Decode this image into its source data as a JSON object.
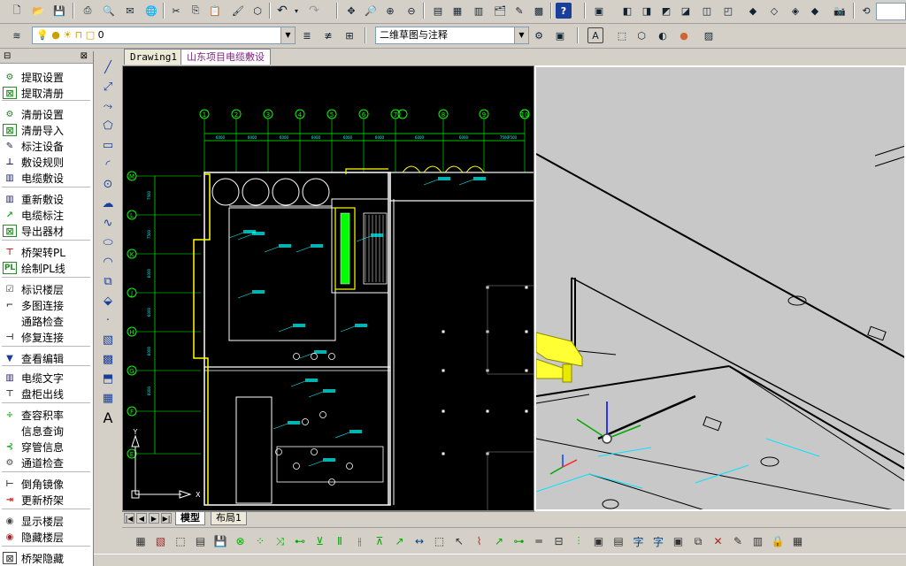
{
  "layer_combo": {
    "value": "0"
  },
  "workspace_combo": {
    "value": "二维草图与注释"
  },
  "document_tabs": [
    {
      "label": "Drawing1"
    },
    {
      "label": "山东项目电缆敷设"
    }
  ],
  "layout_tabs": [
    {
      "label": "模型"
    },
    {
      "label": "布局1"
    }
  ],
  "left_panel": {
    "items": [
      {
        "label": "提取设置",
        "icon": "extract-settings-icon"
      },
      {
        "label": "提取清册",
        "icon": "extract-list-icon"
      },
      {
        "label": "清册设置",
        "icon": "list-settings-icon"
      },
      {
        "label": "清册导入",
        "icon": "list-import-icon"
      },
      {
        "label": "标注设备",
        "icon": "mark-device-icon"
      },
      {
        "label": "敷设规则",
        "icon": "laying-rule-icon"
      },
      {
        "label": "电缆敷设",
        "icon": "cable-laying-icon"
      },
      {
        "label": "重新敷设",
        "icon": "relay-icon"
      },
      {
        "label": "电缆标注",
        "icon": "cable-label-icon"
      },
      {
        "label": "导出器材",
        "icon": "export-material-icon"
      },
      {
        "label": "桥架转PL",
        "icon": "tray-to-pl-icon"
      },
      {
        "label": "绘制PL线",
        "icon": "draw-pl-icon"
      },
      {
        "label": "标识楼层",
        "icon": "mark-floor-icon"
      },
      {
        "label": "多图连接",
        "icon": "multi-connect-icon"
      },
      {
        "label": "通路检查",
        "icon": "path-check-icon"
      },
      {
        "label": "修复连接",
        "icon": "repair-connect-icon"
      },
      {
        "label": "查看编辑",
        "icon": "view-edit-icon"
      },
      {
        "label": "电缆文字",
        "icon": "cable-text-icon"
      },
      {
        "label": "盘柜出线",
        "icon": "cabinet-outlet-icon"
      },
      {
        "label": "查容积率",
        "icon": "fill-ratio-icon"
      },
      {
        "label": "信息查询",
        "icon": "info-query-icon"
      },
      {
        "label": "穿管信息",
        "icon": "conduit-info-icon"
      },
      {
        "label": "通道检查",
        "icon": "channel-check-icon"
      },
      {
        "label": "倒角镜像",
        "icon": "chamfer-mirror-icon"
      },
      {
        "label": "更新桥架",
        "icon": "update-tray-icon"
      },
      {
        "label": "显示楼层",
        "icon": "show-floor-icon"
      },
      {
        "label": "隐藏楼层",
        "icon": "hide-floor-icon"
      },
      {
        "label": "桥架隐藏",
        "icon": "hide-tray-icon"
      }
    ]
  },
  "drawing": {
    "axis_labels_top": [
      "1",
      "2",
      "3",
      "4",
      "5",
      "6",
      "7",
      "8",
      "9",
      "10",
      "11"
    ],
    "axis_labels_left": [
      "M",
      "L",
      "K",
      "J",
      "H",
      "G",
      "F",
      "E"
    ],
    "dims_top": [
      "6000",
      "6000",
      "6000",
      "6000",
      "6000",
      "6000",
      "6000",
      "6000",
      "7500",
      "7500"
    ],
    "dims_left": [
      "7500",
      "7500",
      "6000",
      "6000",
      "6000",
      "6000"
    ],
    "ucs_y": "Y",
    "ucs_x": "X",
    "colors": {
      "wall": "#ffffff",
      "dim": "#00ff00",
      "text": "#00ffff",
      "highlight": "#ffff00",
      "cable": "#00ff00"
    }
  },
  "colors": {
    "ui_bg": "#d4d0c8",
    "model_bg": "#000000",
    "view3d_bg": "#c8c8c8",
    "accent": "#1a3f9a"
  }
}
